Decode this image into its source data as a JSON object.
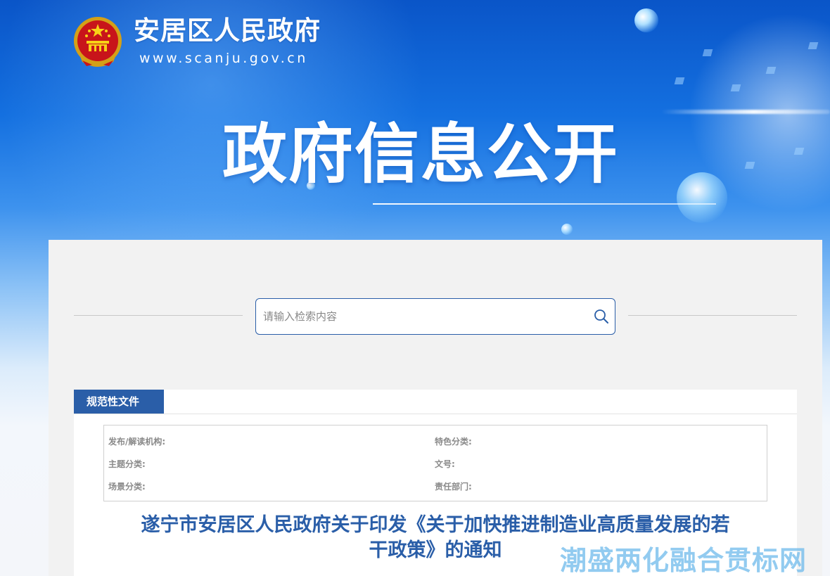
{
  "header": {
    "site_name": "安居区人民政府",
    "site_url": "www.scanju.gov.cn",
    "emblem_icon": "national-emblem-icon"
  },
  "hero": {
    "title": "政府信息公开"
  },
  "search": {
    "placeholder": "请输入检索内容",
    "icon": "search-icon"
  },
  "document": {
    "tab_label": "规范性文件",
    "meta": {
      "publisher_label": "发布/解读机构:",
      "feature_category_label": "特色分类:",
      "topic_category_label": "主题分类:",
      "doc_number_label": "文号:",
      "scene_category_label": "场景分类:",
      "responsible_dept_label": "责任部门:"
    },
    "title_line1": "遂宁市安居区人民政府关于印发《关于加快推进制造业高质量发展的若",
    "title_line2": "干政策》的通知"
  },
  "watermark": {
    "text": "潮盛两化融合贯标网"
  },
  "colors": {
    "accent": "#2a5ea8",
    "banner_top": "#0a55c8",
    "panel_bg": "#f2f2f2"
  }
}
